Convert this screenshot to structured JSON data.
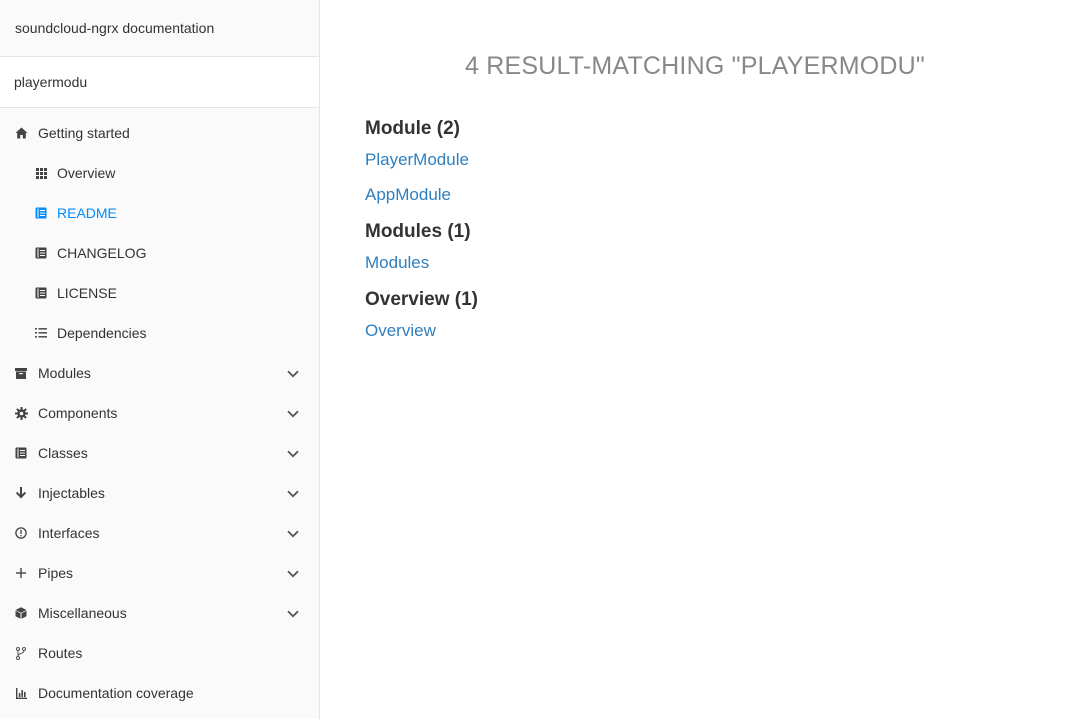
{
  "sidebar": {
    "title": "soundcloud-ngrx documentation",
    "search": {
      "value": "playermodu",
      "placeholder": ""
    },
    "items": [
      {
        "label": "Getting started",
        "icon": "home-icon",
        "level": "top",
        "expandable": false
      },
      {
        "label": "Overview",
        "icon": "grid-icon",
        "level": "sub",
        "expandable": false
      },
      {
        "label": "README",
        "icon": "book-icon",
        "level": "sub",
        "expandable": false,
        "active": true
      },
      {
        "label": "CHANGELOG",
        "icon": "book-icon",
        "level": "sub",
        "expandable": false
      },
      {
        "label": "LICENSE",
        "icon": "book-icon",
        "level": "sub",
        "expandable": false
      },
      {
        "label": "Dependencies",
        "icon": "list-icon",
        "level": "sub",
        "expandable": false
      },
      {
        "label": "Modules",
        "icon": "archive-icon",
        "level": "top",
        "expandable": true
      },
      {
        "label": "Components",
        "icon": "cog-icon",
        "level": "top",
        "expandable": true
      },
      {
        "label": "Classes",
        "icon": "book-icon",
        "level": "top",
        "expandable": true
      },
      {
        "label": "Injectables",
        "icon": "arrow-down-icon",
        "level": "top",
        "expandable": true
      },
      {
        "label": "Interfaces",
        "icon": "info-icon",
        "level": "top",
        "expandable": true
      },
      {
        "label": "Pipes",
        "icon": "plus-icon",
        "level": "top",
        "expandable": true
      },
      {
        "label": "Miscellaneous",
        "icon": "cube-icon",
        "level": "top",
        "expandable": true
      },
      {
        "label": "Routes",
        "icon": "code-fork-icon",
        "level": "top",
        "expandable": false
      },
      {
        "label": "Documentation coverage",
        "icon": "bar-chart-icon",
        "level": "top",
        "expandable": false
      }
    ]
  },
  "main": {
    "heading": "4 result-matching \"playermodu\"",
    "groups": [
      {
        "title": "Module (2)",
        "links": [
          "PlayerModule",
          "AppModule"
        ]
      },
      {
        "title": "Modules (1)",
        "links": [
          "Modules"
        ]
      },
      {
        "title": "Overview (1)",
        "links": [
          "Overview"
        ]
      }
    ]
  },
  "colors": {
    "active": "#008cff",
    "link": "#2f7fbf",
    "heading": "#888888",
    "sidebar_bg": "#fafafa"
  }
}
